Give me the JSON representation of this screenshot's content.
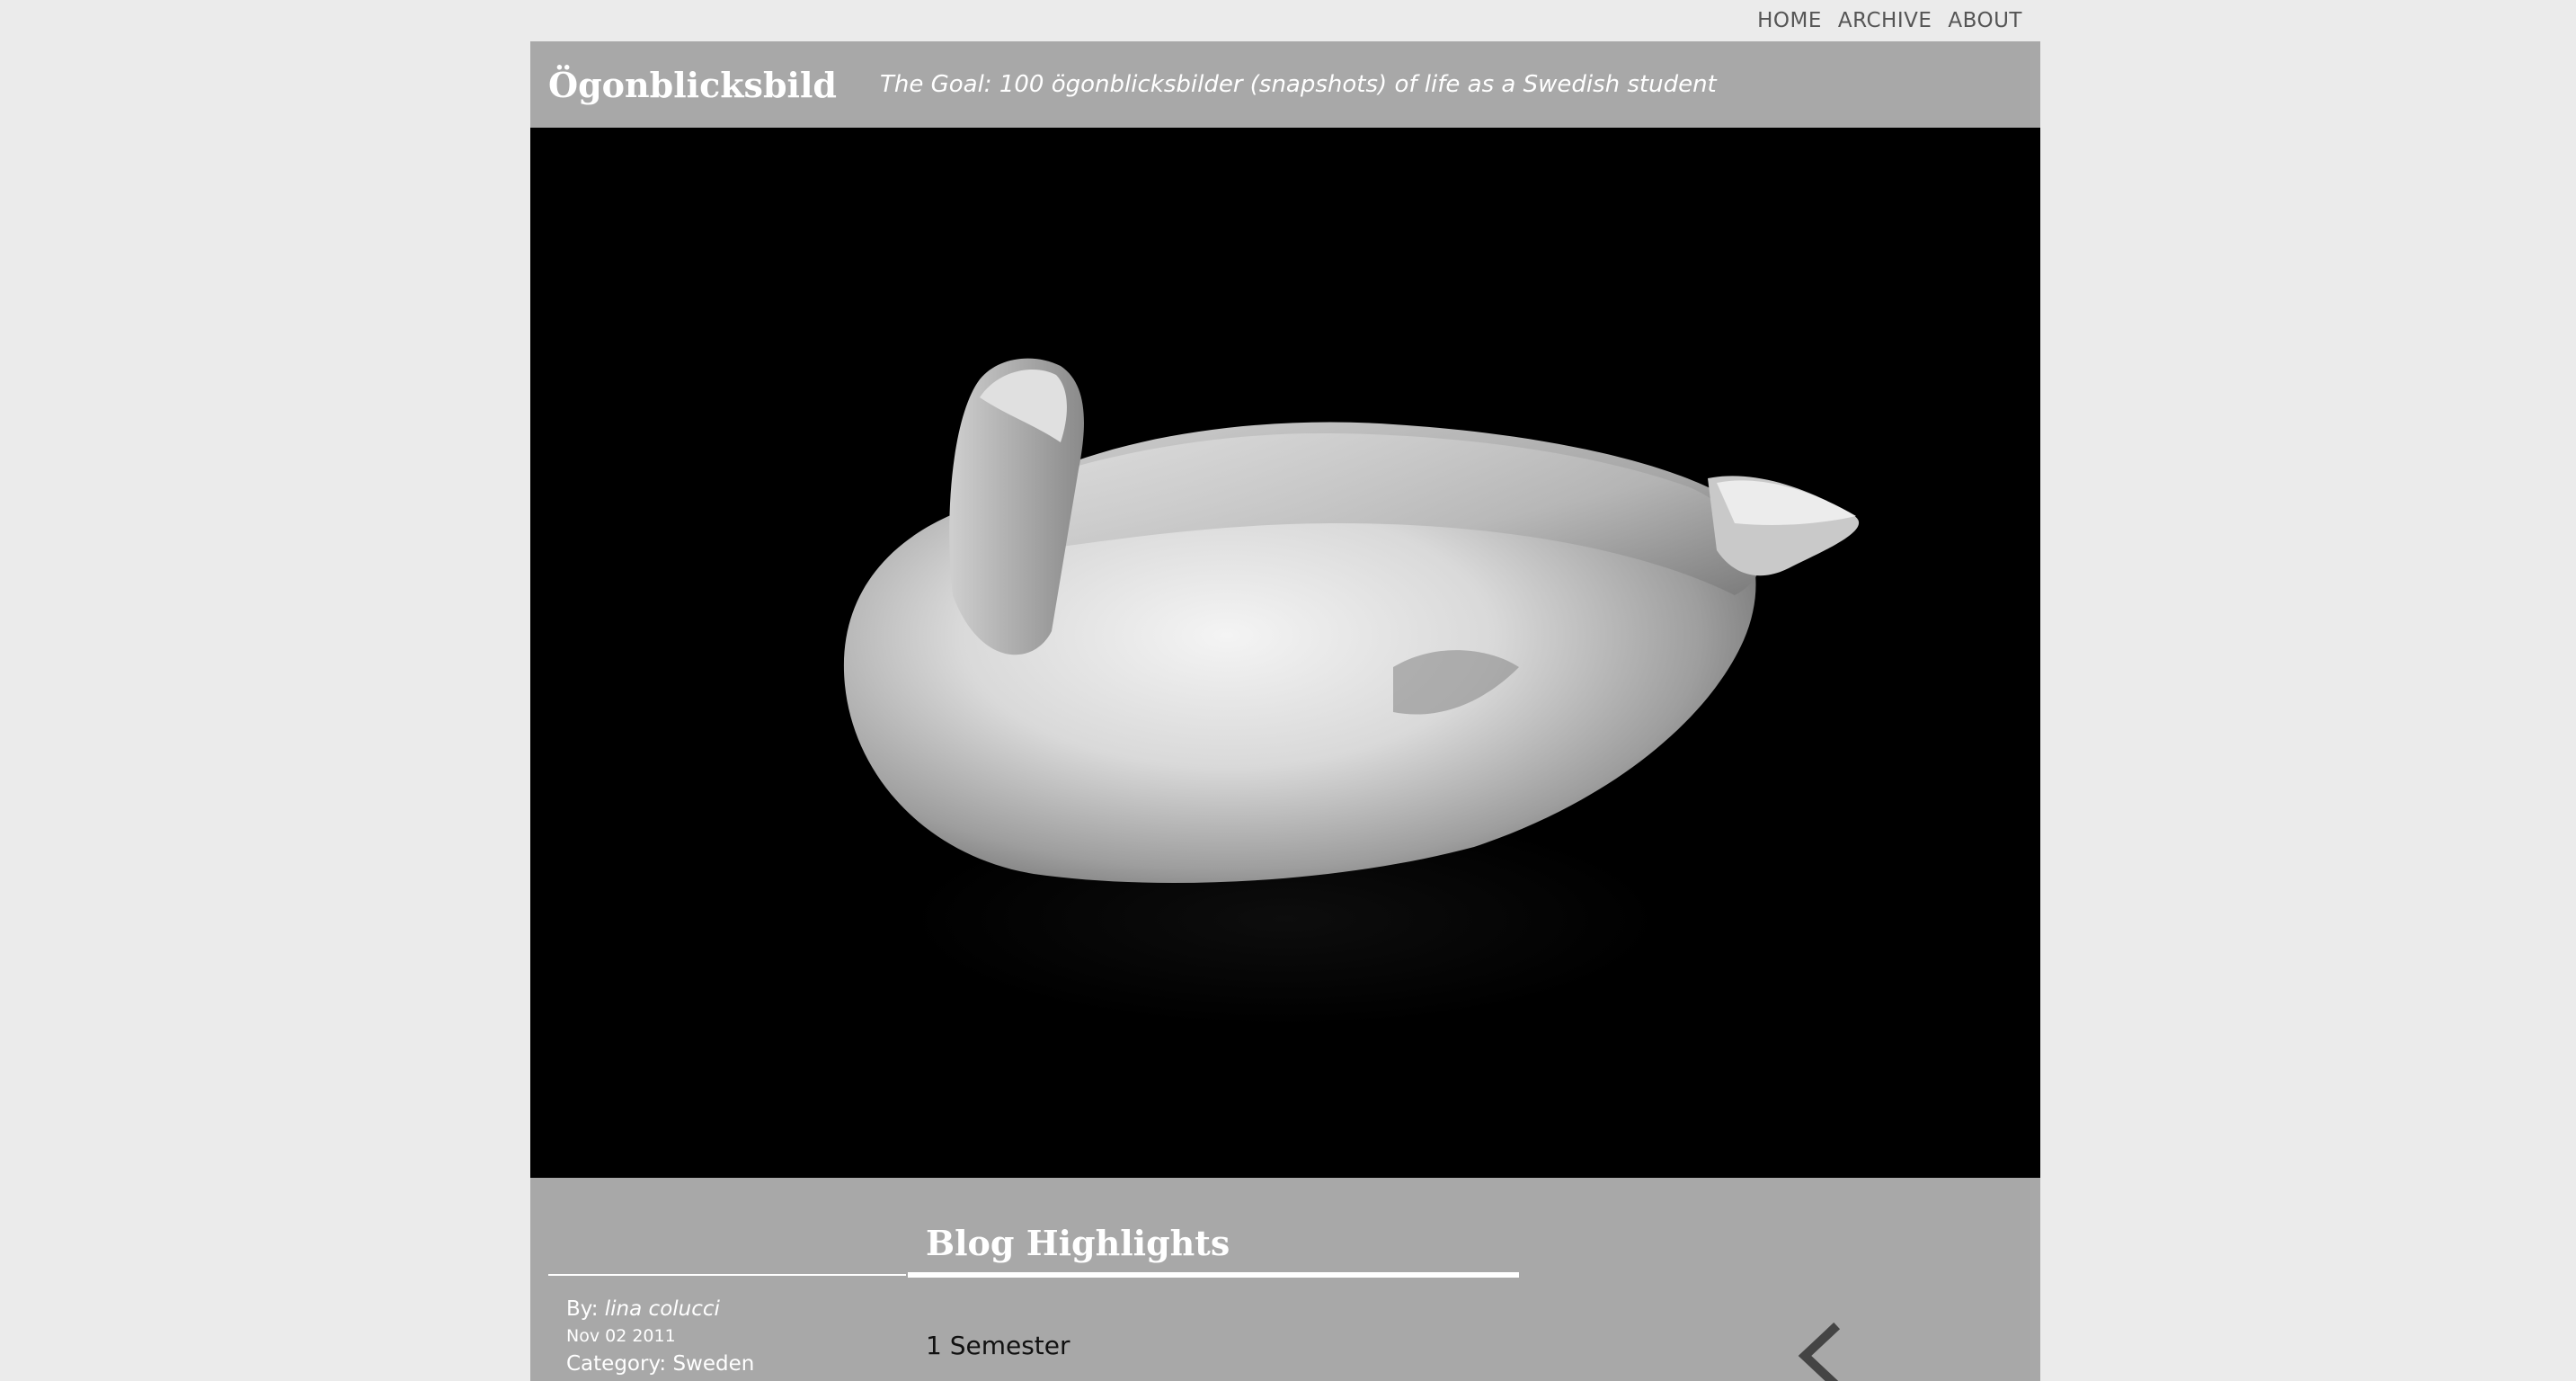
{
  "nav": {
    "items": [
      {
        "label": "HOME"
      },
      {
        "label": "ARCHIVE"
      },
      {
        "label": "ABOUT"
      }
    ]
  },
  "header": {
    "site_title": "Ögonblicksbild",
    "tagline": "The Goal: 100 ögonblicksbilder (snapshots) of life as a Swedish student"
  },
  "hero": {
    "image_icon": "swan-photo"
  },
  "post_meta": {
    "by_label": "By:",
    "author": "lina colucci",
    "date": "Nov 02 2011",
    "category_label": "Category:",
    "category": "Sweden"
  },
  "highlights": {
    "title": "Blog Highlights",
    "items": [
      {
        "label": "1 Semester"
      }
    ]
  },
  "pager": {
    "prev_icon": "chevron-left-icon"
  },
  "colors": {
    "background": "#ebebeb",
    "bar": "#a8a8a8",
    "text_light": "#ffffff",
    "nav_text": "#555555"
  }
}
